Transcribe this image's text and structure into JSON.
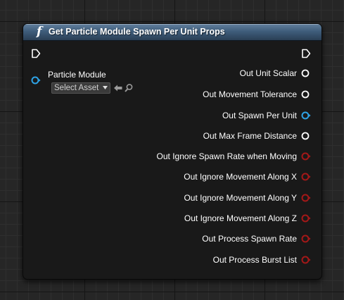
{
  "node": {
    "title": "Get Particle Module Spawn Per Unit Props",
    "function_icon": "function-icon",
    "header_color": "#3f5d7b"
  },
  "inputs": {
    "particle_module": {
      "label": "Particle Module",
      "asset_picker_value": "Select Asset",
      "pin_color": "#2ea3e6"
    },
    "use_selected_icon": "back-arrow-icon",
    "browse_icon": "magnifier-icon"
  },
  "outputs": [
    {
      "label": "Out Unit Scalar",
      "pin_type": "float",
      "pin_color": "#ffffff"
    },
    {
      "label": "Out Movement Tolerance",
      "pin_type": "float",
      "pin_color": "#ffffff"
    },
    {
      "label": "Out Spawn Per Unit",
      "pin_type": "object",
      "pin_color": "#2ea3e6"
    },
    {
      "label": "Out Max Frame Distance",
      "pin_type": "float",
      "pin_color": "#ffffff"
    },
    {
      "label": "Out Ignore Spawn Rate when Moving",
      "pin_type": "bool",
      "pin_color": "#a41818"
    },
    {
      "label": "Out Ignore Movement Along X",
      "pin_type": "bool",
      "pin_color": "#a41818"
    },
    {
      "label": "Out Ignore Movement Along Y",
      "pin_type": "bool",
      "pin_color": "#a41818"
    },
    {
      "label": "Out Ignore Movement Along Z",
      "pin_type": "bool",
      "pin_color": "#a41818"
    },
    {
      "label": "Out Process Spawn Rate",
      "pin_type": "bool",
      "pin_color": "#a41818"
    },
    {
      "label": "Out Process Burst List",
      "pin_type": "bool",
      "pin_color": "#a41818"
    }
  ]
}
